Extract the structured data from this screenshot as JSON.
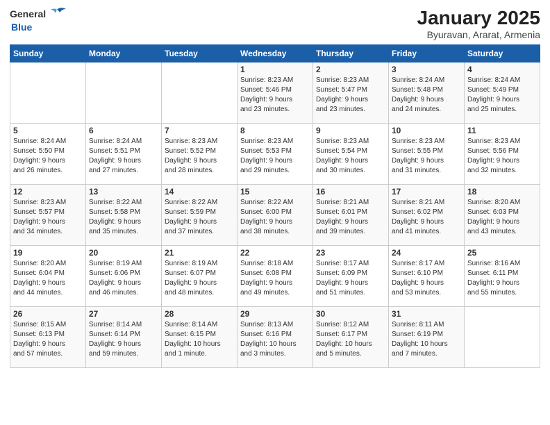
{
  "logo": {
    "general": "General",
    "blue": "Blue"
  },
  "title": "January 2025",
  "subtitle": "Byuravan, Ararat, Armenia",
  "weekdays": [
    "Sunday",
    "Monday",
    "Tuesday",
    "Wednesday",
    "Thursday",
    "Friday",
    "Saturday"
  ],
  "weeks": [
    [
      {
        "day": "",
        "info": ""
      },
      {
        "day": "",
        "info": ""
      },
      {
        "day": "",
        "info": ""
      },
      {
        "day": "1",
        "info": "Sunrise: 8:23 AM\nSunset: 5:46 PM\nDaylight: 9 hours\nand 23 minutes."
      },
      {
        "day": "2",
        "info": "Sunrise: 8:23 AM\nSunset: 5:47 PM\nDaylight: 9 hours\nand 23 minutes."
      },
      {
        "day": "3",
        "info": "Sunrise: 8:24 AM\nSunset: 5:48 PM\nDaylight: 9 hours\nand 24 minutes."
      },
      {
        "day": "4",
        "info": "Sunrise: 8:24 AM\nSunset: 5:49 PM\nDaylight: 9 hours\nand 25 minutes."
      }
    ],
    [
      {
        "day": "5",
        "info": "Sunrise: 8:24 AM\nSunset: 5:50 PM\nDaylight: 9 hours\nand 26 minutes."
      },
      {
        "day": "6",
        "info": "Sunrise: 8:24 AM\nSunset: 5:51 PM\nDaylight: 9 hours\nand 27 minutes."
      },
      {
        "day": "7",
        "info": "Sunrise: 8:23 AM\nSunset: 5:52 PM\nDaylight: 9 hours\nand 28 minutes."
      },
      {
        "day": "8",
        "info": "Sunrise: 8:23 AM\nSunset: 5:53 PM\nDaylight: 9 hours\nand 29 minutes."
      },
      {
        "day": "9",
        "info": "Sunrise: 8:23 AM\nSunset: 5:54 PM\nDaylight: 9 hours\nand 30 minutes."
      },
      {
        "day": "10",
        "info": "Sunrise: 8:23 AM\nSunset: 5:55 PM\nDaylight: 9 hours\nand 31 minutes."
      },
      {
        "day": "11",
        "info": "Sunrise: 8:23 AM\nSunset: 5:56 PM\nDaylight: 9 hours\nand 32 minutes."
      }
    ],
    [
      {
        "day": "12",
        "info": "Sunrise: 8:23 AM\nSunset: 5:57 PM\nDaylight: 9 hours\nand 34 minutes."
      },
      {
        "day": "13",
        "info": "Sunrise: 8:22 AM\nSunset: 5:58 PM\nDaylight: 9 hours\nand 35 minutes."
      },
      {
        "day": "14",
        "info": "Sunrise: 8:22 AM\nSunset: 5:59 PM\nDaylight: 9 hours\nand 37 minutes."
      },
      {
        "day": "15",
        "info": "Sunrise: 8:22 AM\nSunset: 6:00 PM\nDaylight: 9 hours\nand 38 minutes."
      },
      {
        "day": "16",
        "info": "Sunrise: 8:21 AM\nSunset: 6:01 PM\nDaylight: 9 hours\nand 39 minutes."
      },
      {
        "day": "17",
        "info": "Sunrise: 8:21 AM\nSunset: 6:02 PM\nDaylight: 9 hours\nand 41 minutes."
      },
      {
        "day": "18",
        "info": "Sunrise: 8:20 AM\nSunset: 6:03 PM\nDaylight: 9 hours\nand 43 minutes."
      }
    ],
    [
      {
        "day": "19",
        "info": "Sunrise: 8:20 AM\nSunset: 6:04 PM\nDaylight: 9 hours\nand 44 minutes."
      },
      {
        "day": "20",
        "info": "Sunrise: 8:19 AM\nSunset: 6:06 PM\nDaylight: 9 hours\nand 46 minutes."
      },
      {
        "day": "21",
        "info": "Sunrise: 8:19 AM\nSunset: 6:07 PM\nDaylight: 9 hours\nand 48 minutes."
      },
      {
        "day": "22",
        "info": "Sunrise: 8:18 AM\nSunset: 6:08 PM\nDaylight: 9 hours\nand 49 minutes."
      },
      {
        "day": "23",
        "info": "Sunrise: 8:17 AM\nSunset: 6:09 PM\nDaylight: 9 hours\nand 51 minutes."
      },
      {
        "day": "24",
        "info": "Sunrise: 8:17 AM\nSunset: 6:10 PM\nDaylight: 9 hours\nand 53 minutes."
      },
      {
        "day": "25",
        "info": "Sunrise: 8:16 AM\nSunset: 6:11 PM\nDaylight: 9 hours\nand 55 minutes."
      }
    ],
    [
      {
        "day": "26",
        "info": "Sunrise: 8:15 AM\nSunset: 6:13 PM\nDaylight: 9 hours\nand 57 minutes."
      },
      {
        "day": "27",
        "info": "Sunrise: 8:14 AM\nSunset: 6:14 PM\nDaylight: 9 hours\nand 59 minutes."
      },
      {
        "day": "28",
        "info": "Sunrise: 8:14 AM\nSunset: 6:15 PM\nDaylight: 10 hours\nand 1 minute."
      },
      {
        "day": "29",
        "info": "Sunrise: 8:13 AM\nSunset: 6:16 PM\nDaylight: 10 hours\nand 3 minutes."
      },
      {
        "day": "30",
        "info": "Sunrise: 8:12 AM\nSunset: 6:17 PM\nDaylight: 10 hours\nand 5 minutes."
      },
      {
        "day": "31",
        "info": "Sunrise: 8:11 AM\nSunset: 6:19 PM\nDaylight: 10 hours\nand 7 minutes."
      },
      {
        "day": "",
        "info": ""
      }
    ]
  ]
}
